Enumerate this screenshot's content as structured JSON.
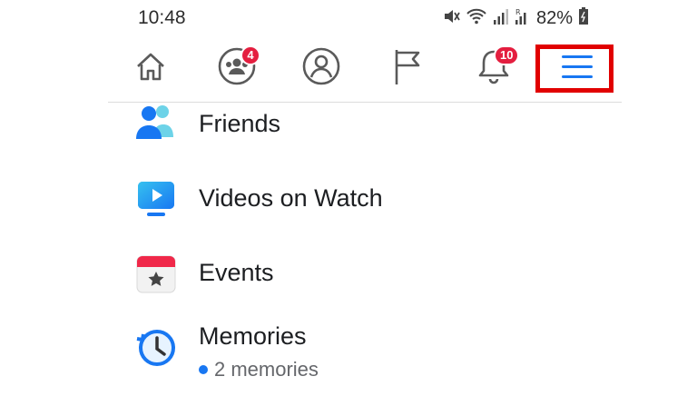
{
  "status_bar": {
    "time": "10:48",
    "battery": "82%"
  },
  "nav": {
    "items": [
      {
        "name": "home",
        "icon": "home-icon"
      },
      {
        "name": "groups",
        "icon": "groups-icon",
        "badge": "4"
      },
      {
        "name": "profile",
        "icon": "profile-icon"
      },
      {
        "name": "pages",
        "icon": "flag-icon"
      },
      {
        "name": "notifications",
        "icon": "bell-icon",
        "badge": "10"
      },
      {
        "name": "menu",
        "icon": "hamburger-menu-icon"
      }
    ]
  },
  "menu": {
    "items": [
      {
        "label": "Friends",
        "icon": "friends-icon"
      },
      {
        "label": "Videos on Watch",
        "icon": "watch-icon"
      },
      {
        "label": "Events",
        "icon": "events-calendar-icon"
      },
      {
        "label": "Memories",
        "icon": "memories-clock-icon",
        "subtitle": "2 memories"
      }
    ]
  },
  "colors": {
    "accent": "#1877f2",
    "badge": "#e41e3f",
    "highlight": "#e10000"
  }
}
